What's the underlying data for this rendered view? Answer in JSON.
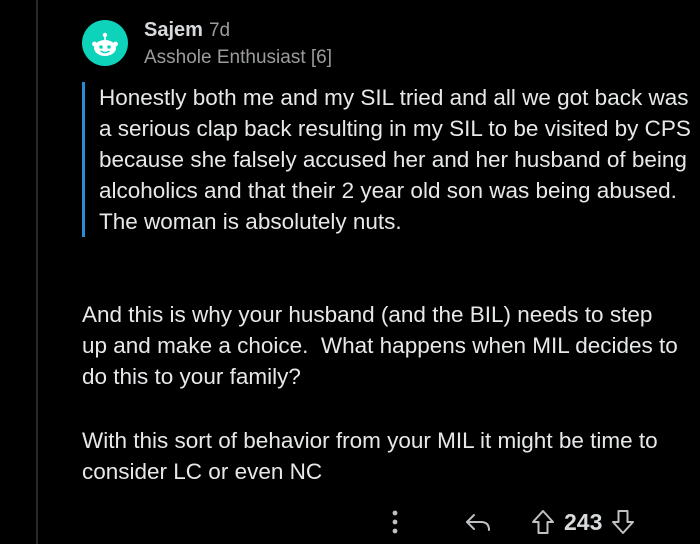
{
  "comment": {
    "author": "Sajem",
    "age": "7d",
    "flair": "Asshole Enthusiast [6]",
    "quote": "Honestly both me and my SIL tried and all we got back was a serious clap back resulting in my SIL to be visited by CPS because she falsely accused her and her husband of being alcoholics and that their 2 year old son was being abused. The woman is absolutely nuts.",
    "paragraphs": [
      "And this is why your husband (and the BIL) needs to step up and make a choice.  What happens when MIL decides to do this to your family?",
      "With this sort of behavior from your MIL it might be time to consider LC or even NC"
    ],
    "score": "243"
  },
  "icons": {
    "avatar": "snoo-avatar-icon",
    "more": "more-vertical-icon",
    "reply": "reply-arrow-icon",
    "upvote": "upvote-arrow-icon",
    "downvote": "downvote-arrow-icon"
  },
  "colors": {
    "background": "#000000",
    "avatar": "#0dd3bb",
    "quote_bar": "#2b8bd3",
    "text": "#e6e8ea",
    "muted": "#9a9c9e"
  }
}
